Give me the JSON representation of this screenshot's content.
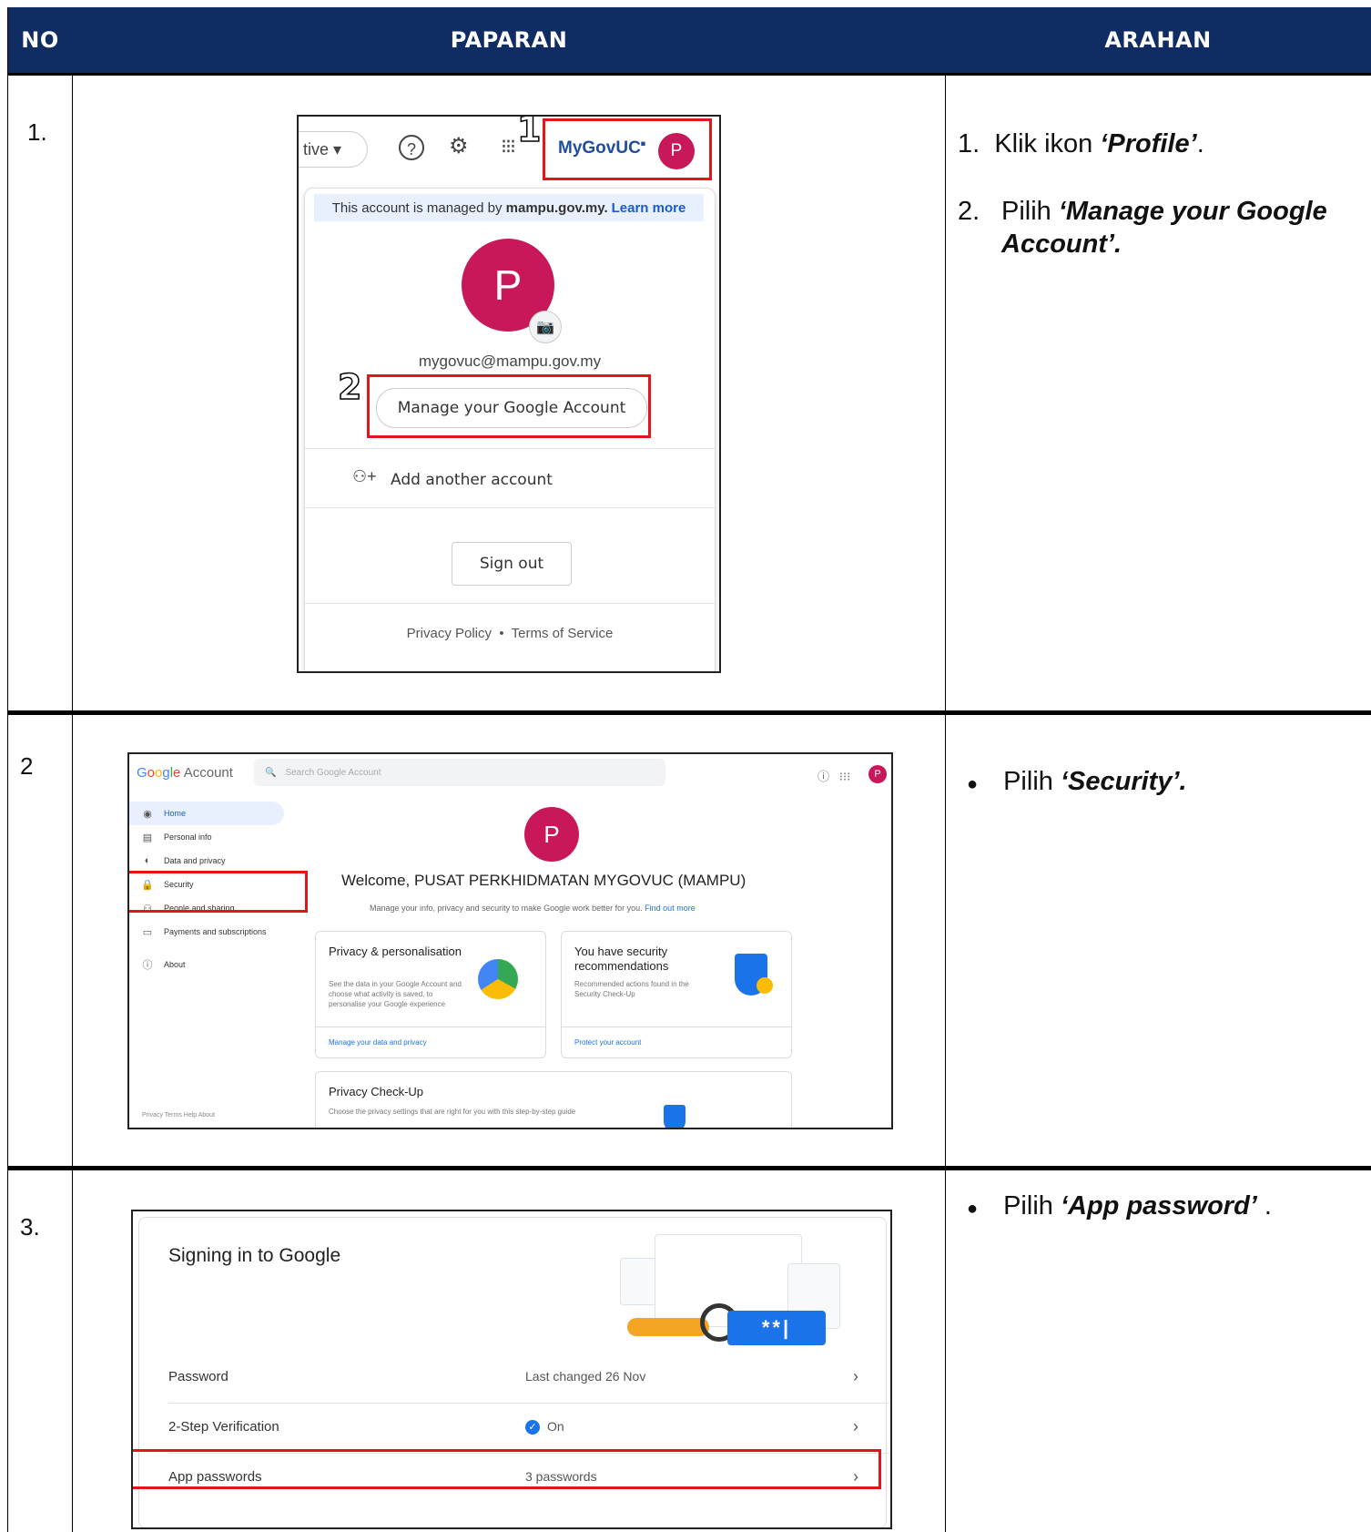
{
  "table": {
    "headers": {
      "no": "NO",
      "paparan": "PAPARAN",
      "arahan": "ARAHAN"
    }
  },
  "rows": [
    {
      "no": "1.",
      "steps": [
        {
          "num": "1.",
          "text": "Klik ikon ",
          "emph": "‘Profile’",
          "tail": "."
        },
        {
          "num": "2.",
          "text": "Pilih ",
          "emph": "‘Manage your Google Account’.",
          "tail": ""
        }
      ]
    },
    {
      "no": "2",
      "bullet": {
        "text": "Pilih ",
        "emph": "‘Security’.",
        "tail": ""
      }
    },
    {
      "no": "3.",
      "bullet": {
        "text": "Pilih ",
        "emph": "‘App password’",
        "tail": " ."
      }
    }
  ],
  "panel1": {
    "pill_text": "tive ▾",
    "brand": "MyGovUC",
    "avatar_letter": "P",
    "step1": "1",
    "step2": "2",
    "banner_text": "This account is managed by",
    "banner_domain": "mampu.gov.my.",
    "banner_link": "Learn more",
    "email": "mygovuc@mampu.gov.my",
    "manage_button": "Manage your Google Account",
    "add_account": "Add another account",
    "sign_out": "Sign out",
    "privacy": "Privacy Policy",
    "terms": "Terms of Service"
  },
  "panel2": {
    "logo": "Google Account",
    "search_placeholder": "Search Google Account",
    "avatar_letter": "P",
    "nav": [
      "Home",
      "Personal info",
      "Data and privacy",
      "Security",
      "People and sharing",
      "Payments and subscriptions",
      "About"
    ],
    "welcome": "Welcome, PUSAT PERKHIDMATAN MYGOVUC (MAMPU)",
    "subtitle": "Manage your info, privacy and security to make Google work better for you.",
    "subtitle_link": "Find out more",
    "card1_title": "Privacy & personalisation",
    "card1_desc": "See the data in your Google Account and choose what activity is saved, to personalise your Google experience",
    "card1_link": "Manage your data and privacy",
    "card2_title": "You have security recommendations",
    "card2_desc": "Recommended actions found in the Security Check-Up",
    "card2_link": "Protect your account",
    "card3_title": "Privacy Check-Up",
    "card3_desc": "Choose the privacy settings that are right for you with this step-by-step guide",
    "footer": "Privacy   Terms   Help   About"
  },
  "panel3": {
    "title": "Signing in to Google",
    "rows": [
      {
        "label": "Password",
        "value": "Last changed 26 Nov"
      },
      {
        "label": "2-Step Verification",
        "value": "On"
      },
      {
        "label": "App passwords",
        "value": "3 passwords"
      }
    ],
    "password_mask": "**|"
  },
  "colors": {
    "header_bg": "#0f2d63",
    "highlight": "#e0161b",
    "avatar": "#c8185a",
    "link": "#1a73e8"
  }
}
